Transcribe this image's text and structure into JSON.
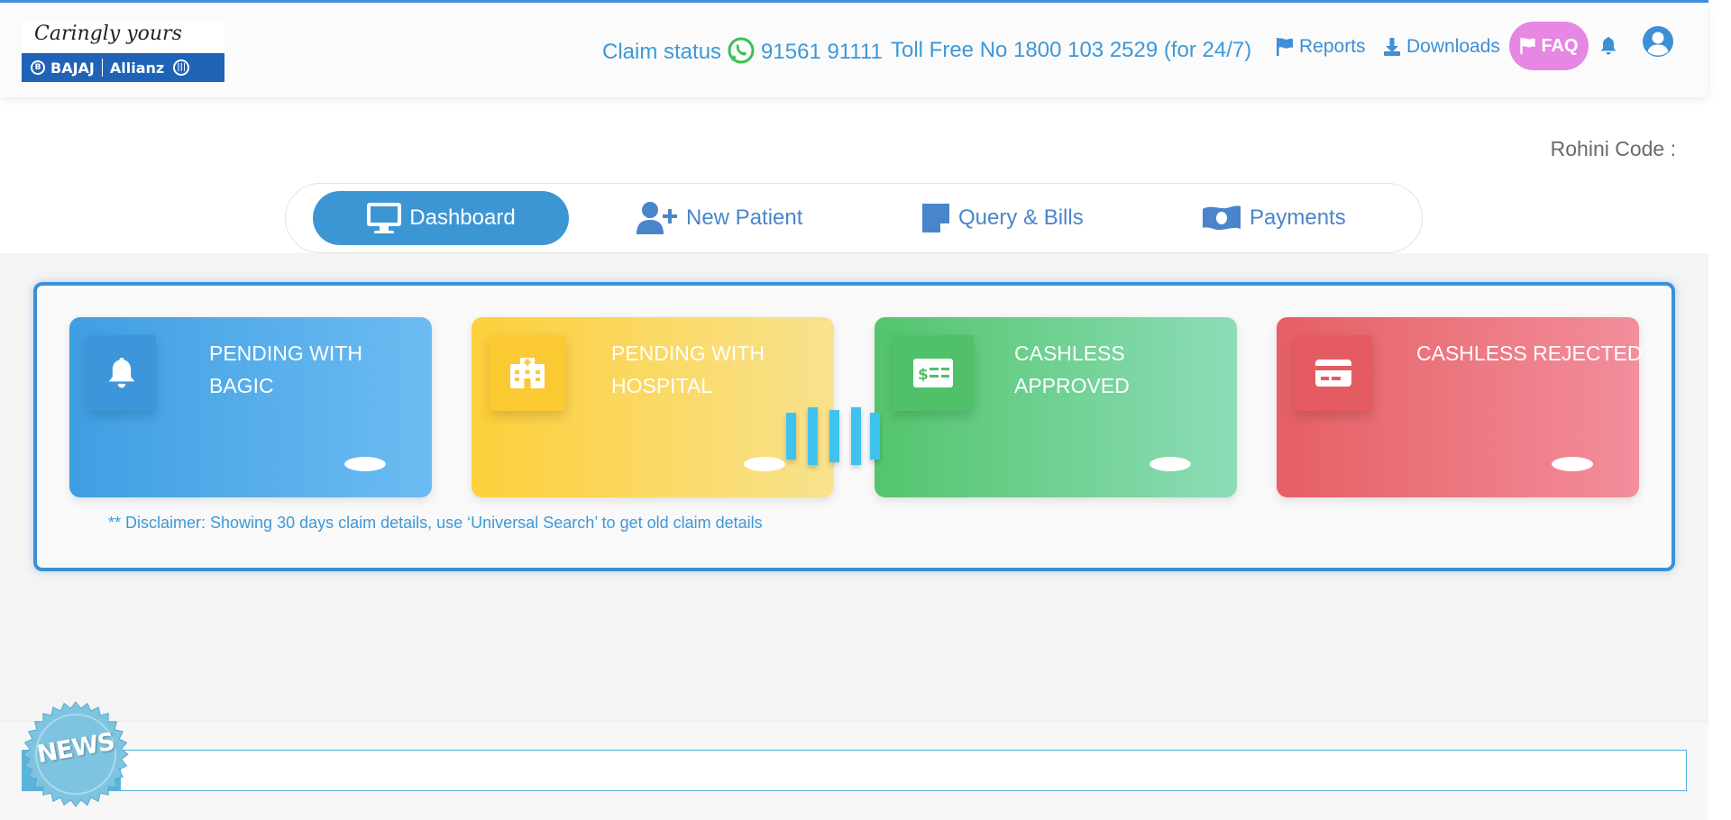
{
  "header": {
    "logo": {
      "tagline": "Caringly yours",
      "brand_left": "BAJAJ",
      "brand_right": "Allianz"
    },
    "claim_status_label": "Claim status",
    "claim_phone": "91561 91111",
    "toll_free": "Toll Free No 1800 103 2529 (for 24/7)",
    "reports_label": "Reports",
    "downloads_label": "Downloads",
    "faq_label": "FAQ",
    "icons": [
      "whatsapp-icon",
      "flag-icon",
      "download-icon",
      "bell-icon",
      "user-circle-icon"
    ]
  },
  "rohini_label": "Rohini Code :",
  "tabs": [
    {
      "label": "Dashboard",
      "icon": "monitor-icon",
      "active": true
    },
    {
      "label": "New Patient",
      "icon": "user-plus-icon",
      "active": false
    },
    {
      "label": "Query & Bills",
      "icon": "sticky-note-icon",
      "active": false
    },
    {
      "label": "Payments",
      "icon": "money-bill-icon",
      "active": false
    }
  ],
  "cards": [
    {
      "title": "PENDING WITH BAGIC",
      "icon": "bell-icon",
      "color": "#4aa8e8"
    },
    {
      "title": "PENDING WITH HOSPITAL",
      "icon": "hospital-icon",
      "color": "#fcd34d"
    },
    {
      "title": "CASHLESS APPROVED",
      "icon": "money-check-icon",
      "color": "#5fcb80"
    },
    {
      "title": "CASHLESS REJECTED",
      "icon": "credit-card-icon",
      "color": "#ea6b72"
    }
  ],
  "disclaimer": "** Disclaimer: Showing 30 days claim details, use ‘Universal Search’ to get old claim details",
  "news_label": "NEWS",
  "colors": {
    "primary": "#3d8fd6",
    "faq": "#e587e3",
    "text_link": "#3d98d8"
  }
}
